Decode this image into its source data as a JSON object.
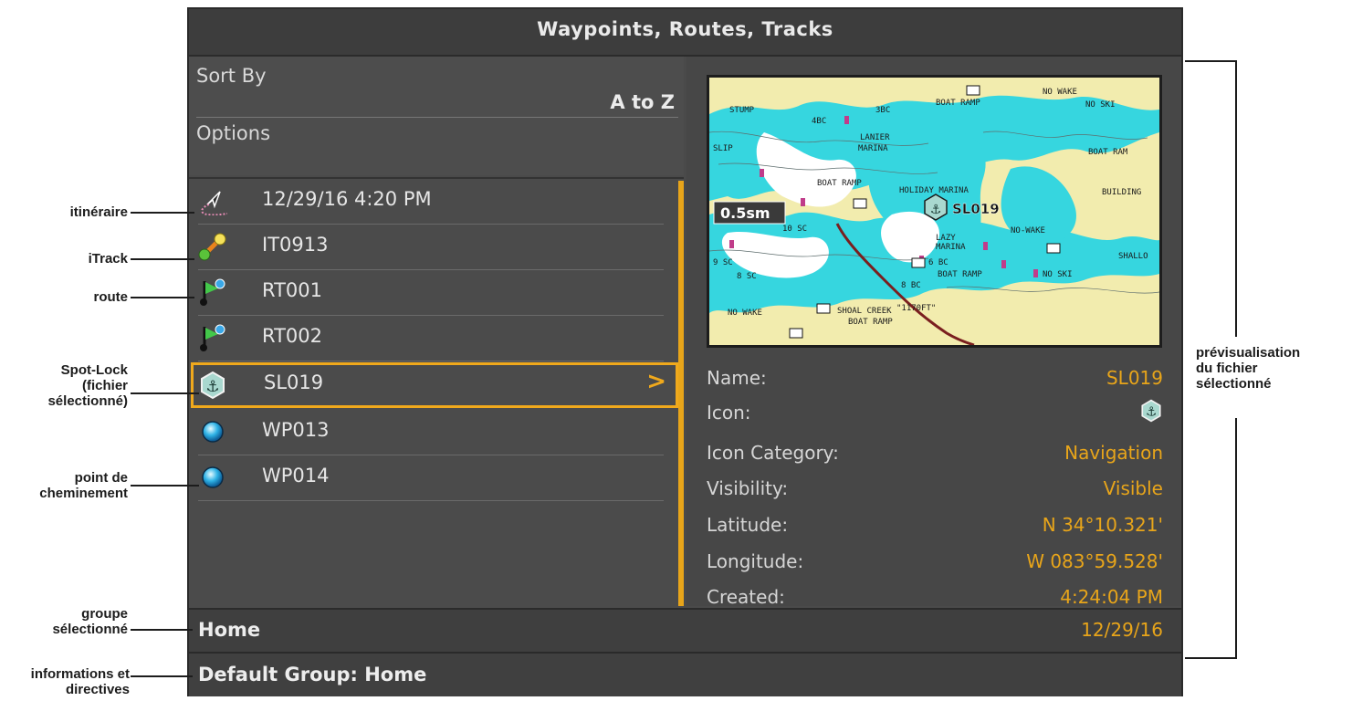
{
  "title": "Waypoints, Routes, Tracks",
  "sort": {
    "label": "Sort By",
    "value": "A to Z",
    "options_label": "Options"
  },
  "list": [
    {
      "icon": "route-cursor-icon",
      "label": "12/29/16 4:20 PM"
    },
    {
      "icon": "itrack-icon",
      "label": "IT0913"
    },
    {
      "icon": "route-flag-icon",
      "label": "RT001"
    },
    {
      "icon": "route-flag-icon",
      "label": "RT002"
    },
    {
      "icon": "spot-lock-anchor-icon",
      "label": "SL019",
      "selected": true
    },
    {
      "icon": "waypoint-icon",
      "label": "WP013"
    },
    {
      "icon": "waypoint-icon",
      "label": "WP014"
    }
  ],
  "selected_chevron": ">",
  "group": "Home",
  "footer": "Default Group: Home",
  "map": {
    "scale": "0.5sm",
    "marker_label": "SL019",
    "labels": [
      "STUMP",
      "4BC",
      "3BC",
      "BOAT RAMP",
      "NO WAKE",
      "NO SKI",
      "SLIP",
      "LANIER",
      "MARINA",
      "BOAT RAM",
      "BOAT RAMP",
      "HOLIDAY MARINA",
      "BUILDING",
      "10 SC",
      "LAZY",
      "MARINA",
      "NO-WAKE",
      "SHALLO",
      "8 SC",
      "6 BC",
      "BOAT RAMP",
      "8 BC",
      "NO SKI",
      "\"1170FT\"",
      "SHOAL CREEK",
      "BOAT RAMP",
      "NO WAKE",
      "9 SC"
    ]
  },
  "details": {
    "name_label": "Name:",
    "name_value": "SL019",
    "icon_label": "Icon:",
    "category_label": "Icon Category:",
    "category_value": "Navigation",
    "visibility_label": "Visibility:",
    "visibility_value": "Visible",
    "latitude_label": "Latitude:",
    "latitude_value": "N 34°10.321'",
    "longitude_label": "Longitude:",
    "longitude_value": "W 083°59.528'",
    "created_label": "Created:",
    "created_time": "4:24:04 PM",
    "created_date": "12/29/16"
  },
  "annotations": {
    "itineraire": "itinéraire",
    "itrack": "iTrack",
    "route": "route",
    "spotlock_1": "Spot-Lock",
    "spotlock_2": "(fichier",
    "spotlock_3": "sélectionné)",
    "waypoint_1": "point de",
    "waypoint_2": "cheminement",
    "group_1": "groupe",
    "group_2": "sélectionné",
    "info_1": "informations et",
    "info_2": "directives",
    "preview_1": "prévisualisation",
    "preview_2": "du fichier",
    "preview_3": "sélectionné"
  },
  "colors": {
    "accent": "#e8a51a",
    "screen_bg": "#4a4a4a",
    "water": "#35d7e0",
    "land": "#f2ecae"
  }
}
